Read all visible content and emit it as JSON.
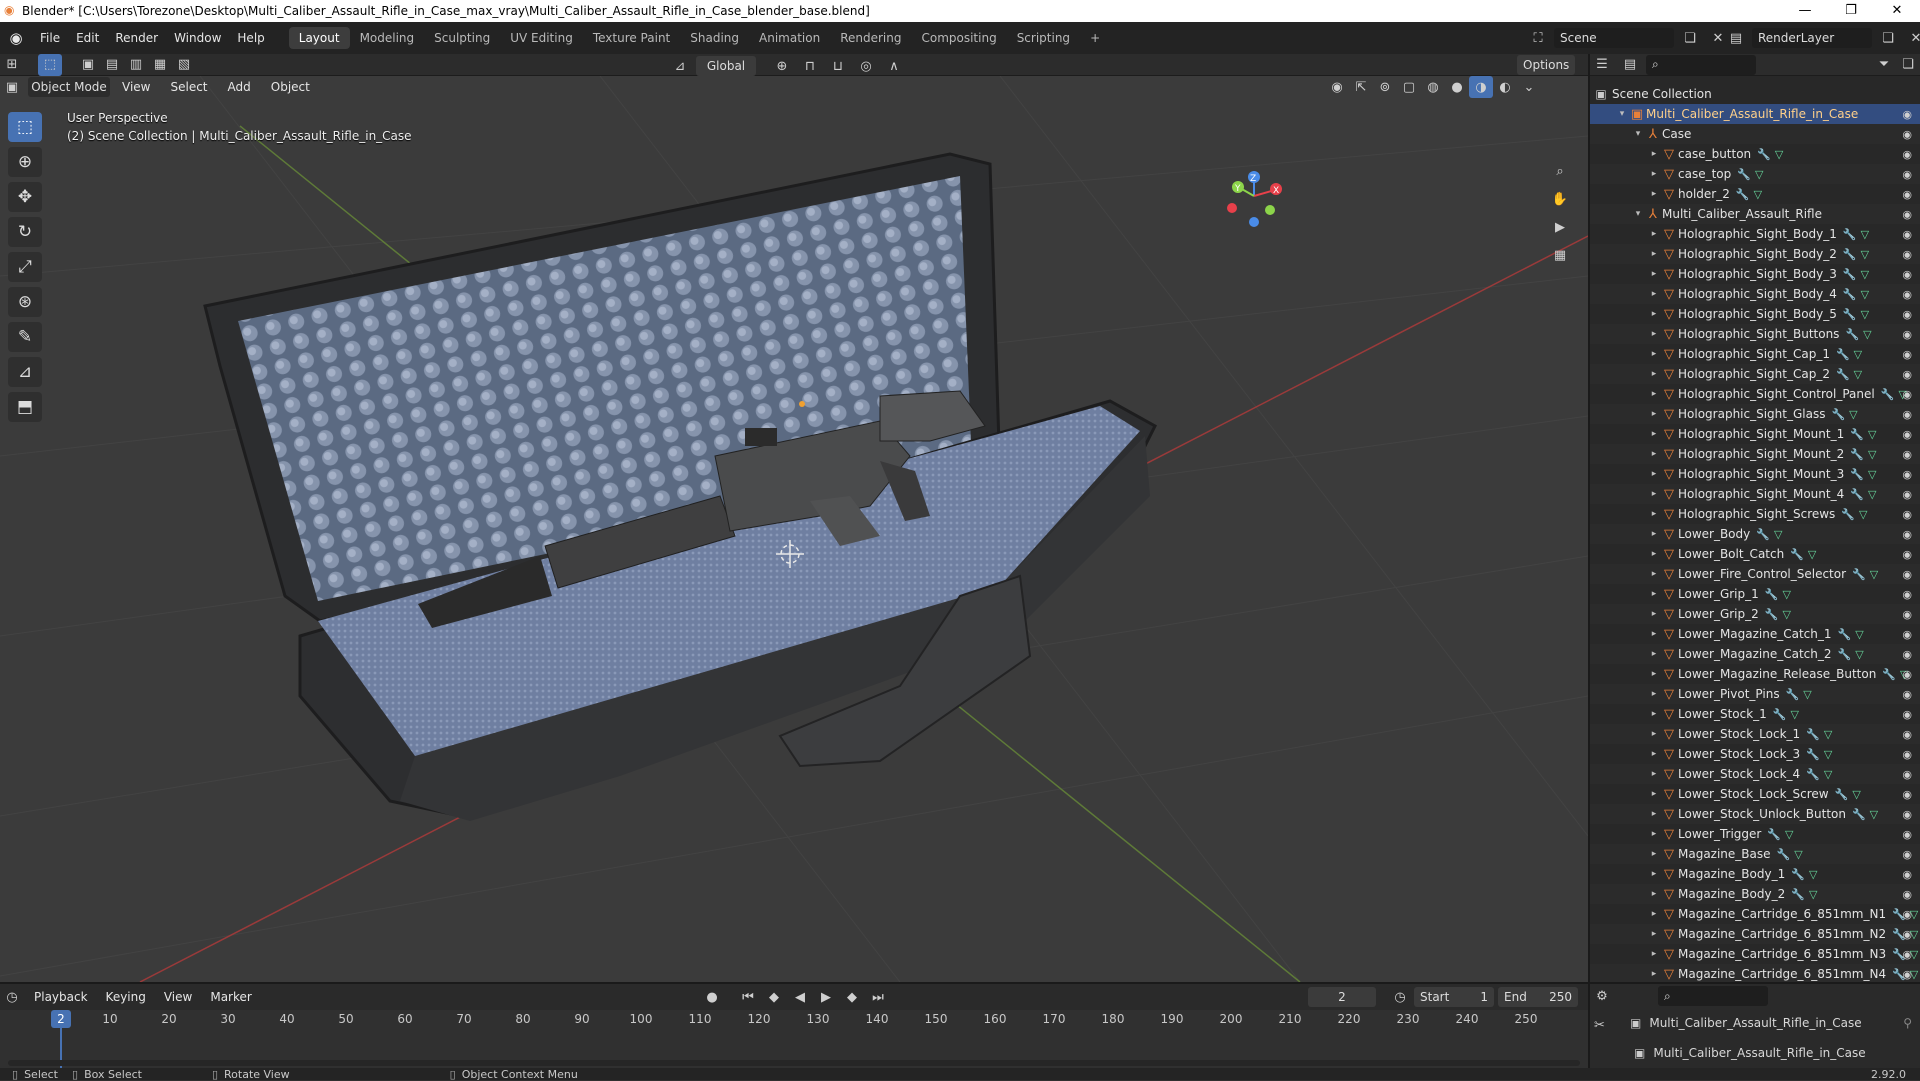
{
  "window": {
    "title": "Blender* [C:\\Users\\Torezone\\Desktop\\Multi_Caliber_Assault_Rifle_in_Case_max_vray\\Multi_Caliber_Assault_Rifle_in_Case_blender_base.blend]",
    "minimize": "—",
    "maximize": "❐",
    "close": "✕"
  },
  "menus": [
    "File",
    "Edit",
    "Render",
    "Window",
    "Help"
  ],
  "workspaces": [
    "Layout",
    "Modeling",
    "Sculpting",
    "UV Editing",
    "Texture Paint",
    "Shading",
    "Animation",
    "Rendering",
    "Compositing",
    "Scripting"
  ],
  "active_workspace": "Layout",
  "scene_name": "Scene",
  "render_layer": "RenderLayer",
  "viewport": {
    "transform_orientation": "Global",
    "options_label": "Options",
    "mode": "Object Mode",
    "header_menus": [
      "View",
      "Select",
      "Add",
      "Object"
    ],
    "perspective": "User Perspective",
    "collection_info": "(2) Scene Collection | Multi_Caliber_Assault_Rifle_in_Case"
  },
  "gizmo": {
    "x": "X",
    "y": "Y",
    "z": "Z"
  },
  "outliner": {
    "scene_collection": "Scene Collection",
    "rows": [
      {
        "name": "Multi_Caliber_Assault_Rifle_in_Case",
        "depth": 1,
        "kind": "collection",
        "selected": true
      },
      {
        "name": "Case",
        "depth": 2,
        "kind": "empty"
      },
      {
        "name": "case_button",
        "depth": 3,
        "kind": "mesh"
      },
      {
        "name": "case_top",
        "depth": 3,
        "kind": "mesh"
      },
      {
        "name": "holder_2",
        "depth": 3,
        "kind": "mesh"
      },
      {
        "name": "Multi_Caliber_Assault_Rifle",
        "depth": 2,
        "kind": "empty"
      },
      {
        "name": "Holographic_Sight_Body_1",
        "depth": 3,
        "kind": "mesh"
      },
      {
        "name": "Holographic_Sight_Body_2",
        "depth": 3,
        "kind": "mesh"
      },
      {
        "name": "Holographic_Sight_Body_3",
        "depth": 3,
        "kind": "mesh"
      },
      {
        "name": "Holographic_Sight_Body_4",
        "depth": 3,
        "kind": "mesh"
      },
      {
        "name": "Holographic_Sight_Body_5",
        "depth": 3,
        "kind": "mesh"
      },
      {
        "name": "Holographic_Sight_Buttons",
        "depth": 3,
        "kind": "mesh"
      },
      {
        "name": "Holographic_Sight_Cap_1",
        "depth": 3,
        "kind": "mesh"
      },
      {
        "name": "Holographic_Sight_Cap_2",
        "depth": 3,
        "kind": "mesh"
      },
      {
        "name": "Holographic_Sight_Control_Panel",
        "depth": 3,
        "kind": "mesh"
      },
      {
        "name": "Holographic_Sight_Glass",
        "depth": 3,
        "kind": "mesh"
      },
      {
        "name": "Holographic_Sight_Mount_1",
        "depth": 3,
        "kind": "mesh"
      },
      {
        "name": "Holographic_Sight_Mount_2",
        "depth": 3,
        "kind": "mesh"
      },
      {
        "name": "Holographic_Sight_Mount_3",
        "depth": 3,
        "kind": "mesh"
      },
      {
        "name": "Holographic_Sight_Mount_4",
        "depth": 3,
        "kind": "mesh"
      },
      {
        "name": "Holographic_Sight_Screws",
        "depth": 3,
        "kind": "mesh"
      },
      {
        "name": "Lower_Body",
        "depth": 3,
        "kind": "mesh"
      },
      {
        "name": "Lower_Bolt_Catch",
        "depth": 3,
        "kind": "mesh"
      },
      {
        "name": "Lower_Fire_Control_Selector",
        "depth": 3,
        "kind": "mesh"
      },
      {
        "name": "Lower_Grip_1",
        "depth": 3,
        "kind": "mesh"
      },
      {
        "name": "Lower_Grip_2",
        "depth": 3,
        "kind": "mesh"
      },
      {
        "name": "Lower_Magazine_Catch_1",
        "depth": 3,
        "kind": "mesh"
      },
      {
        "name": "Lower_Magazine_Catch_2",
        "depth": 3,
        "kind": "mesh"
      },
      {
        "name": "Lower_Magazine_Release_Button",
        "depth": 3,
        "kind": "mesh"
      },
      {
        "name": "Lower_Pivot_Pins",
        "depth": 3,
        "kind": "mesh"
      },
      {
        "name": "Lower_Stock_1",
        "depth": 3,
        "kind": "mesh"
      },
      {
        "name": "Lower_Stock_Lock_1",
        "depth": 3,
        "kind": "mesh"
      },
      {
        "name": "Lower_Stock_Lock_3",
        "depth": 3,
        "kind": "mesh"
      },
      {
        "name": "Lower_Stock_Lock_4",
        "depth": 3,
        "kind": "mesh"
      },
      {
        "name": "Lower_Stock_Lock_Screw",
        "depth": 3,
        "kind": "mesh"
      },
      {
        "name": "Lower_Stock_Unlock_Button",
        "depth": 3,
        "kind": "mesh"
      },
      {
        "name": "Lower_Trigger",
        "depth": 3,
        "kind": "mesh"
      },
      {
        "name": "Magazine_Base",
        "depth": 3,
        "kind": "mesh"
      },
      {
        "name": "Magazine_Body_1",
        "depth": 3,
        "kind": "mesh"
      },
      {
        "name": "Magazine_Body_2",
        "depth": 3,
        "kind": "mesh"
      },
      {
        "name": "Magazine_Cartridge_6_851mm_N1",
        "depth": 3,
        "kind": "mesh"
      },
      {
        "name": "Magazine_Cartridge_6_851mm_N2",
        "depth": 3,
        "kind": "mesh"
      },
      {
        "name": "Magazine_Cartridge_6_851mm_N3",
        "depth": 3,
        "kind": "mesh"
      },
      {
        "name": "Magazine_Cartridge_6_851mm_N4",
        "depth": 3,
        "kind": "mesh"
      }
    ]
  },
  "timeline": {
    "menus": [
      "Playback",
      "Keying",
      "View",
      "Marker"
    ],
    "current_frame": "2",
    "start_label": "Start",
    "start": "1",
    "end_label": "End",
    "end": "250",
    "ticks": [
      "10",
      "20",
      "30",
      "40",
      "50",
      "60",
      "70",
      "80",
      "90",
      "100",
      "110",
      "120",
      "130",
      "140",
      "150",
      "160",
      "170",
      "180",
      "190",
      "200",
      "210",
      "220",
      "230",
      "240",
      "250"
    ]
  },
  "properties": {
    "object_name": "Multi_Caliber_Assault_Rifle_in_Case",
    "collection_name": "Multi_Caliber_Assault_Rifle_in_Case"
  },
  "status": {
    "select": "Select",
    "box_select": "Box Select",
    "rotate_view": "Rotate View",
    "context_menu": "Object Context Menu",
    "version": "2.92.0"
  },
  "colors": {
    "accent": "#4772b3",
    "selection": "#334d80",
    "object_orange": "#e8803a",
    "axis_x": "#e8404a",
    "axis_y": "#8cd44a",
    "axis_z": "#4a8ce8"
  }
}
